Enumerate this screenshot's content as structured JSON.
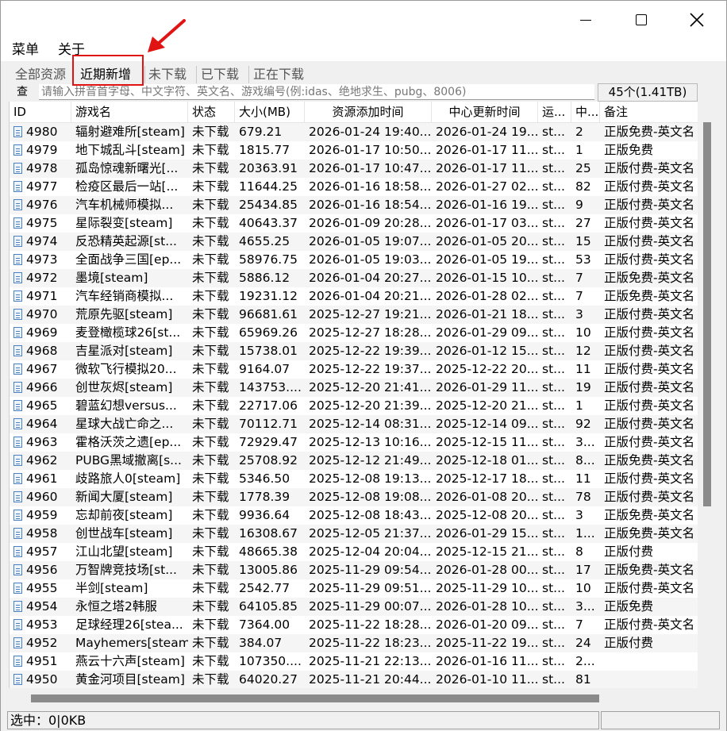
{
  "menu": {
    "items": [
      "菜单",
      "关于"
    ]
  },
  "tabs": [
    "全部资源",
    "近期新增",
    "未下载",
    "已下载",
    "正在下载"
  ],
  "search": {
    "label": "查",
    "placeholder": "请输入拼音首字母、中文字符、英文名、游戏编号(例:idas、绝地求生、pubg、8006)",
    "count": "45个(1.41TB)"
  },
  "table": {
    "columns": [
      "ID",
      "游戏名",
      "状态",
      "大小(MB)",
      "资源添加时间",
      "中心更新时间",
      "运...",
      "中...",
      "备注"
    ],
    "rows": [
      [
        "4980",
        "辐射避难所[steam]",
        "未下载",
        "679.21",
        "2026-01-24 19:40...",
        "2026-01-24 19...",
        "st...",
        "2",
        "正版免费-英文名"
      ],
      [
        "4979",
        "地下城乱斗[steam]",
        "未下载",
        "1815.77",
        "2026-01-17 10:50...",
        "2026-01-17 11...",
        "st...",
        "1",
        "正版免费"
      ],
      [
        "4978",
        "孤岛惊魂新曙光[...",
        "未下载",
        "20363.91",
        "2026-01-17 10:47...",
        "2026-01-17 11...",
        "st...",
        "25",
        "正版付费-英文名"
      ],
      [
        "4977",
        "检疫区最后一站[...",
        "未下载",
        "11644.25",
        "2026-01-16 18:58...",
        "2026-01-27 02...",
        "st...",
        "82",
        "正版付费-英文名"
      ],
      [
        "4976",
        "汽车机械师模拟...",
        "未下载",
        "25434.85",
        "2026-01-16 18:54...",
        "2026-01-16 19...",
        "st...",
        "9",
        "正版付费-英文名"
      ],
      [
        "4975",
        "星际裂变[steam]",
        "未下载",
        "40643.37",
        "2026-01-09 20:28...",
        "2026-01-17 03...",
        "st...",
        "27",
        "正版付费-英文名"
      ],
      [
        "4974",
        "反恐精英起源[st...",
        "未下载",
        "4655.25",
        "2026-01-05 19:07...",
        "2026-01-05 20...",
        "st...",
        "15",
        "正版付费-英文名"
      ],
      [
        "4973",
        "全面战争三国[ep...",
        "未下载",
        "58976.75",
        "2026-01-05 19:03...",
        "2026-01-05 19...",
        "st...",
        "53",
        "正版付费-英文名"
      ],
      [
        "4972",
        "墨境[steam]",
        "未下载",
        "5886.12",
        "2026-01-04 20:27...",
        "2026-01-15 10...",
        "st...",
        "7",
        "正版免费-英文名"
      ],
      [
        "4971",
        "汽车经销商模拟...",
        "未下载",
        "19231.12",
        "2026-01-04 20:21...",
        "2026-01-28 02...",
        "st...",
        "7",
        "正版免费-英文名"
      ],
      [
        "4970",
        "荒原先驱[steam]",
        "未下载",
        "96681.61",
        "2025-12-27 19:21...",
        "2026-01-21 18...",
        "st...",
        "3",
        "正版付费-英文名"
      ],
      [
        "4969",
        "麦登橄榄球26[st...",
        "未下载",
        "65969.26",
        "2025-12-27 18:28...",
        "2026-01-29 09...",
        "st...",
        "10",
        "正版付费-英文名"
      ],
      [
        "4968",
        "吉星派对[steam]",
        "未下载",
        "15738.01",
        "2025-12-22 19:39...",
        "2026-01-12 15...",
        "st...",
        "12",
        "正版付费-英文名"
      ],
      [
        "4967",
        "微软飞行模拟20...",
        "未下载",
        "9164.07",
        "2025-12-22 19:37...",
        "2025-12-22 20...",
        "st...",
        "11",
        "正版付费-英文名"
      ],
      [
        "4966",
        "创世灰烬[steam]",
        "未下载",
        "143753....",
        "2025-12-20 21:41...",
        "2026-01-29 11...",
        "st...",
        "19",
        "正版付费-英文名"
      ],
      [
        "4965",
        "碧蓝幻想versus...",
        "未下载",
        "22717.06",
        "2025-12-20 21:39...",
        "2025-12-20 21...",
        "st...",
        "1",
        "正版付费-英文名"
      ],
      [
        "4964",
        "星球大战亡命之...",
        "未下载",
        "70112.71",
        "2025-12-14 08:31...",
        "2025-12-14 09...",
        "st...",
        "92",
        "正版付费-英文名"
      ],
      [
        "4963",
        "霍格沃茨之遗[ep...",
        "未下载",
        "72929.47",
        "2025-12-13 10:16...",
        "2025-12-15 11...",
        "st...",
        "3...",
        "正版付费-英文名"
      ],
      [
        "4962",
        "PUBG黑域撤离[s...",
        "未下载",
        "25708.92",
        "2025-12-12 21:49...",
        "2025-12-18 01...",
        "st...",
        "8...",
        "正版免费-英文名"
      ],
      [
        "4961",
        "歧路旅人0[steam]",
        "未下载",
        "5346.50",
        "2025-12-08 19:13...",
        "2025-12-17 18...",
        "st...",
        "11",
        "正版付费-英文名"
      ],
      [
        "4960",
        "新闻大厦[steam]",
        "未下载",
        "1778.39",
        "2025-12-08 19:08...",
        "2026-01-08 20...",
        "st...",
        "78",
        "正版付费-英文名"
      ],
      [
        "4959",
        "忘却前夜[steam]",
        "未下载",
        "9936.64",
        "2025-12-08 18:43...",
        "2025-12-08 20...",
        "st...",
        "3",
        "正版免费-英文名"
      ],
      [
        "4958",
        "创世战车[steam]",
        "未下载",
        "16308.67",
        "2025-12-05 21:37...",
        "2026-01-29 15...",
        "st...",
        "1...",
        "正版免费-英文名"
      ],
      [
        "4957",
        "江山北望[steam]",
        "未下载",
        "48665.38",
        "2025-12-04 20:04...",
        "2025-12-15 21...",
        "st...",
        "8",
        "正版付费"
      ],
      [
        "4956",
        "万智牌竞技场[st...",
        "未下载",
        "13005.86",
        "2025-11-29 09:54...",
        "2026-01-28 00...",
        "st...",
        "17",
        "正版免费-英文名"
      ],
      [
        "4955",
        "半剑[steam]",
        "未下载",
        "2542.77",
        "2025-11-29 09:51...",
        "2025-11-29 10...",
        "st...",
        "10",
        "正版付费-英文名"
      ],
      [
        "4954",
        "永恒之塔2韩服",
        "未下载",
        "64105.85",
        "2025-11-29 00:07...",
        "2026-01-28 10...",
        "st...",
        "3...",
        "正版免费"
      ],
      [
        "4953",
        "足球经理26[stea...",
        "未下载",
        "7364.00",
        "2025-11-22 18:28...",
        "2026-01-20 09...",
        "st...",
        "7",
        "正版付费-英文名"
      ],
      [
        "4952",
        "Mayhemers[steam]",
        "未下载",
        "384.07",
        "2025-11-22 18:23...",
        "2025-11-22 19...",
        "st...",
        "24",
        "正版付费"
      ],
      [
        "4951",
        "燕云十六声[steam]",
        "未下载",
        "107350....",
        "2025-11-21 22:13...",
        "2026-01-16 11...",
        "st...",
        "2...",
        ""
      ],
      [
        "4950",
        "黄金河项目[steam]",
        "未下载",
        "64020.27",
        "2025-11-21 20:44...",
        "2026-01-10 11...",
        "st...",
        "81",
        ""
      ]
    ]
  },
  "status": {
    "text": "选中：0|0KB"
  },
  "colors": {
    "annotation": "#e11414",
    "row_stripe": "#f5f5f5",
    "scroll_thumb": "#8a8a8a"
  }
}
